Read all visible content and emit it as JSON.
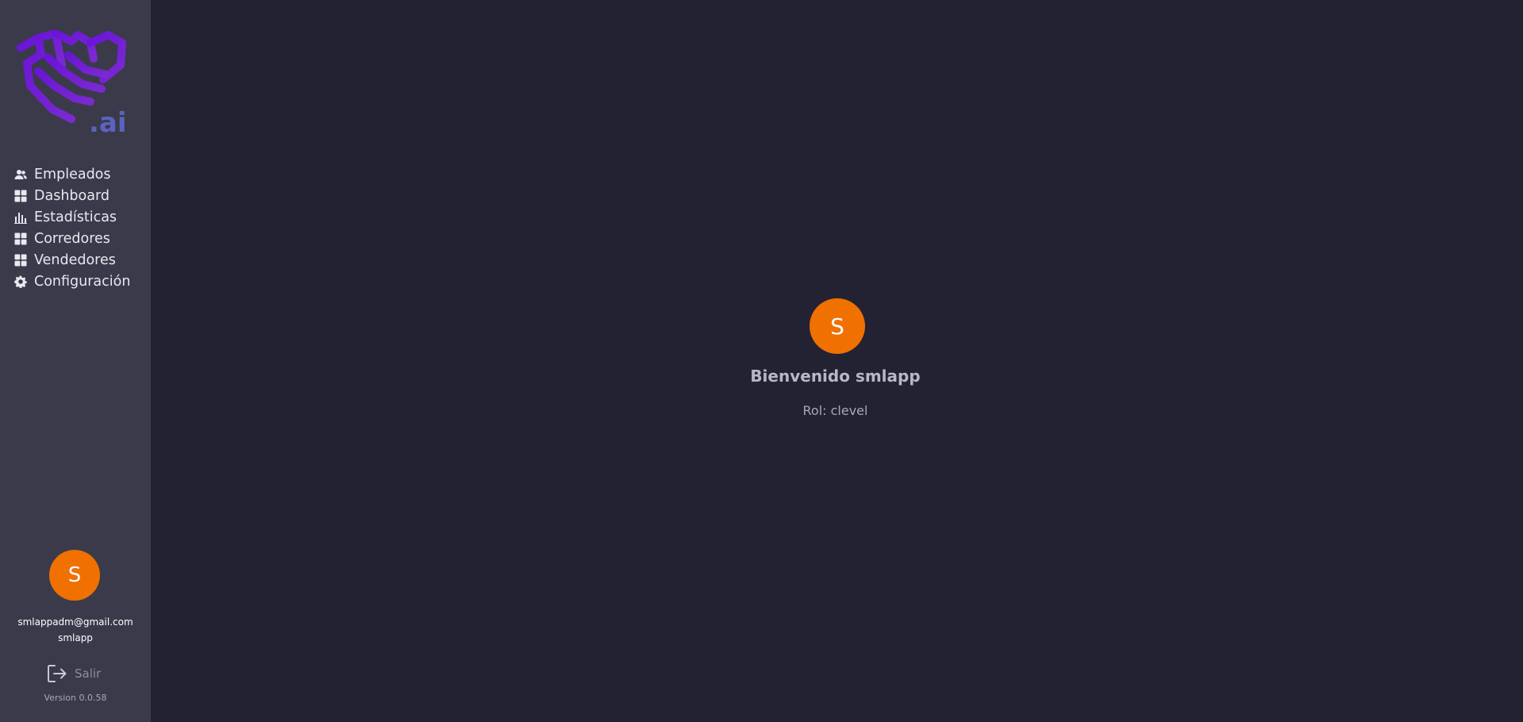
{
  "brand": {
    "logo_text": ".ai",
    "logo_color": "#6b1fd6",
    "logo_accent_color": "#5b63b8"
  },
  "sidebar": {
    "items": [
      {
        "label": "Empleados",
        "icon": "people-icon"
      },
      {
        "label": "Dashboard",
        "icon": "grid-icon"
      },
      {
        "label": "Estadísticas",
        "icon": "bar-chart-icon"
      },
      {
        "label": "Corredores",
        "icon": "grid-icon"
      },
      {
        "label": "Vendedores",
        "icon": "grid-icon"
      },
      {
        "label": "Configuración",
        "icon": "gear-icon"
      }
    ],
    "user": {
      "avatar_letter": "S",
      "email": "smlappadm@gmail.com",
      "username": "smlapp"
    },
    "logout_label": "Salir",
    "version": "Version 0.0.58"
  },
  "main": {
    "avatar_letter": "S",
    "welcome": "Bienvenido smlapp",
    "role": "Rol: clevel"
  },
  "colors": {
    "sidebar_bg": "#3b3a4b",
    "main_bg": "#232233",
    "avatar": "#f07000"
  }
}
